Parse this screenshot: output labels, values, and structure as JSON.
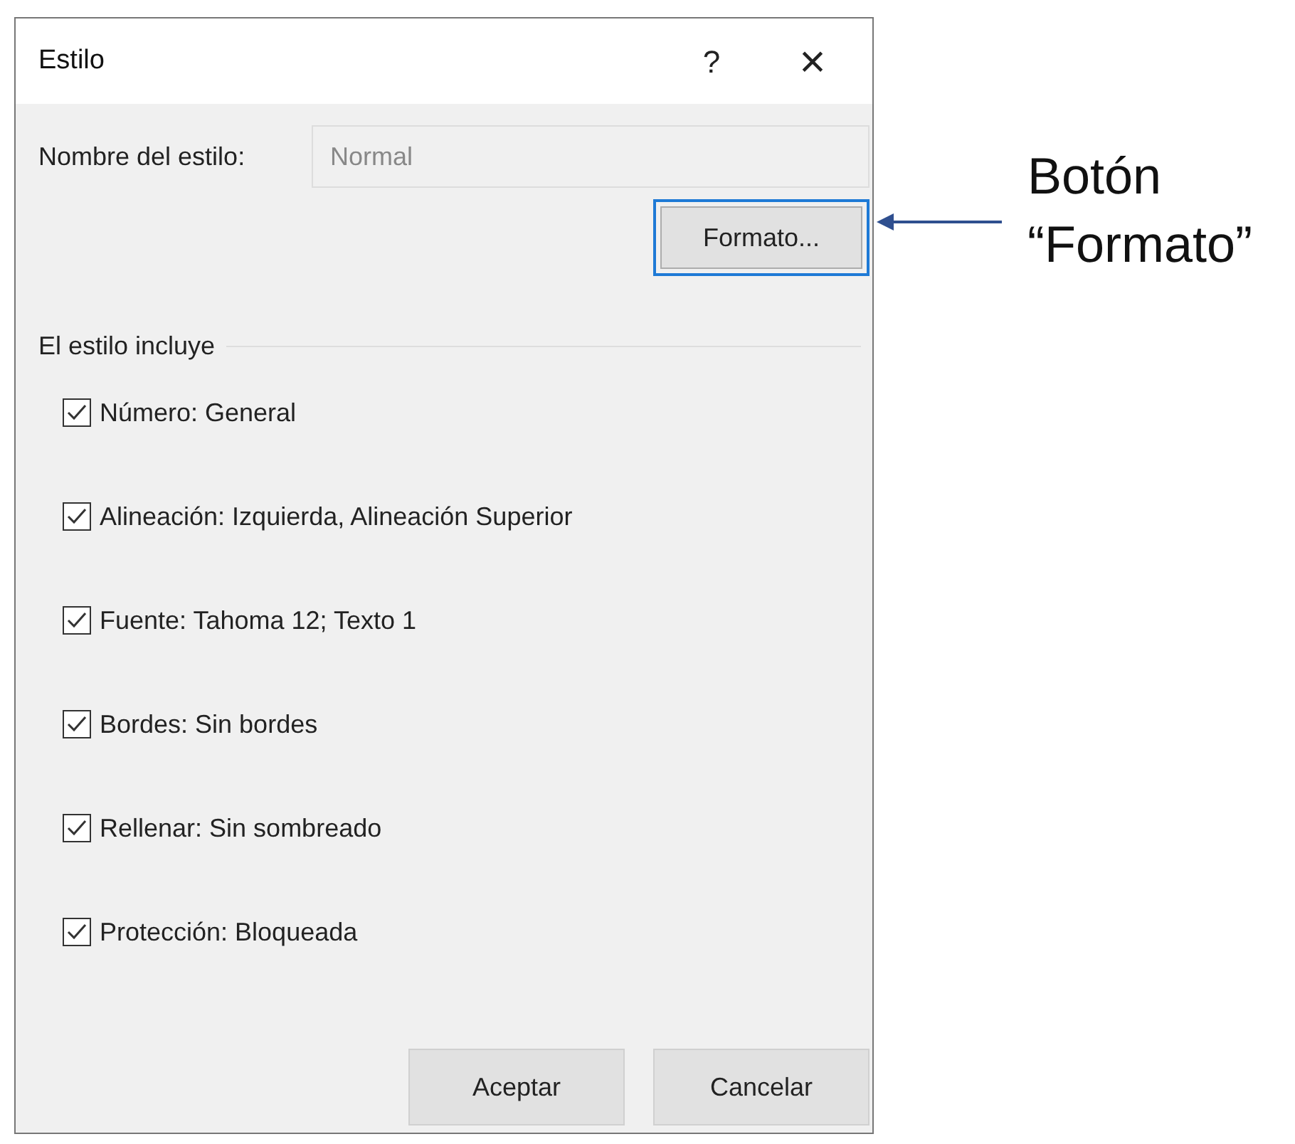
{
  "window": {
    "title": "Estilo",
    "help": "?",
    "close": "×"
  },
  "style_name": {
    "label": "Nombre del estilo:",
    "value": "Normal",
    "disabled": true
  },
  "format_button": {
    "label": "Formato...",
    "focused": true
  },
  "group": {
    "label": "El estilo incluye"
  },
  "items": [
    {
      "label": "Número: General",
      "checked": true
    },
    {
      "label": "Alineación: Izquierda, Alineación Superior",
      "checked": true
    },
    {
      "label": "Fuente: Tahoma 12; Texto 1",
      "checked": true
    },
    {
      "label": "Bordes: Sin bordes",
      "checked": true
    },
    {
      "label": "Rellenar: Sin sombreado",
      "checked": true
    },
    {
      "label": "Protección: Bloqueada",
      "checked": true
    }
  ],
  "buttons": [
    "Aceptar",
    "Cancelar"
  ],
  "annotation": {
    "lines": [
      "Botón",
      "“Formato”"
    ]
  }
}
